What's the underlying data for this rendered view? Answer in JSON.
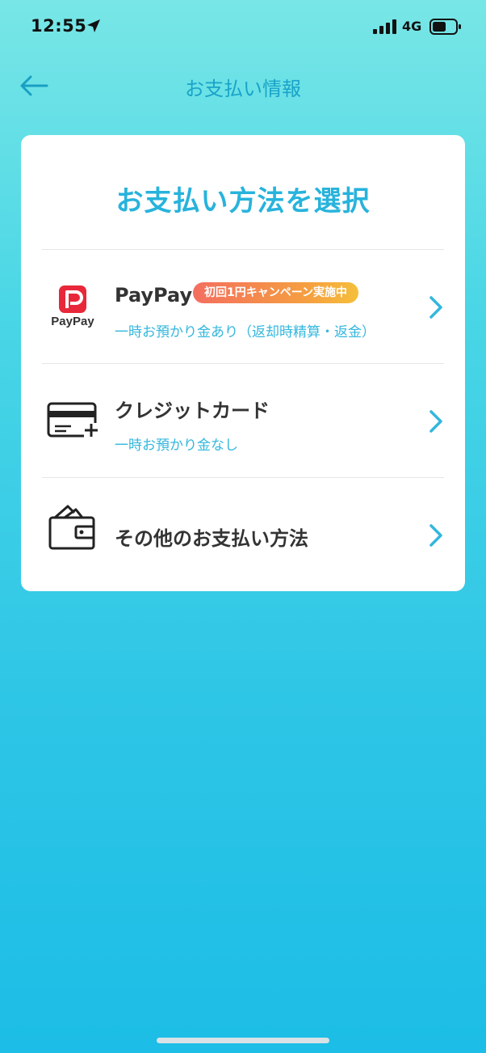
{
  "status_bar": {
    "time": "12:55",
    "network": "4G",
    "icons": [
      "location-arrow-icon",
      "signal-icon",
      "battery-icon"
    ]
  },
  "nav": {
    "title": "お支払い情報",
    "back_icon": "arrow-left-icon"
  },
  "card": {
    "title": "お支払い方法を選択",
    "options": [
      {
        "name": "PayPay",
        "badge": "初回1円キャンペーン実施中",
        "subtitle": "一時お預かり金あり（返却時精算・返金）",
        "icon": "paypay-logo-icon",
        "icon_caption": "PayPay"
      },
      {
        "name": "クレジットカード",
        "subtitle": "一時お預かり金なし",
        "icon": "credit-card-icon"
      },
      {
        "name": "その他のお支払い方法",
        "icon": "wallet-icon"
      }
    ]
  },
  "colors": {
    "accent": "#27b3dc",
    "nav_title": "#1aa3c9",
    "paypay_red": "#e8283a",
    "badge_start": "#f36e5f",
    "badge_end": "#f5bf3a",
    "background_top": "#78e6e6",
    "background_bottom": "#1cbde6"
  }
}
